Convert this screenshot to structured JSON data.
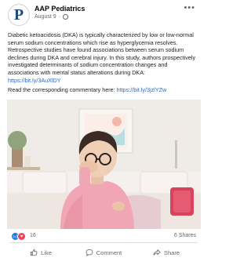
{
  "post": {
    "page_name": "AAP Pediatrics",
    "date": "August 9",
    "avatar_letter": "P",
    "more_label": "•••",
    "body": "Diabetic ketoacidosis (DKA) is typically characterized by low or low-normal serum sodium concentrations which rise as hyperglycemia resolves. Retrospective studies have found associations between serum sodium declines during DKA and cerebral injury. In this study, authors prospectively investigated determinants of sodium concentration changes and associations with mental status alterations during DKA: ",
    "body_link": "https://bit.ly/3AuXlDY",
    "commentary_prefix": "Read the corresponding commentary here: ",
    "commentary_link": "https://bit.ly/3jzlYZw"
  },
  "reactions": {
    "count": "16",
    "shares": "6 Shares"
  },
  "actions": {
    "like": "Like",
    "comment": "Comment",
    "share": "Share"
  },
  "colors": {
    "link": "#2d69c9",
    "like_blue": "#1b74e4",
    "love_red": "#f33e58",
    "wall": "#ece7e2",
    "couch": "#efe8e4",
    "shirt": "#f0a6b4"
  }
}
